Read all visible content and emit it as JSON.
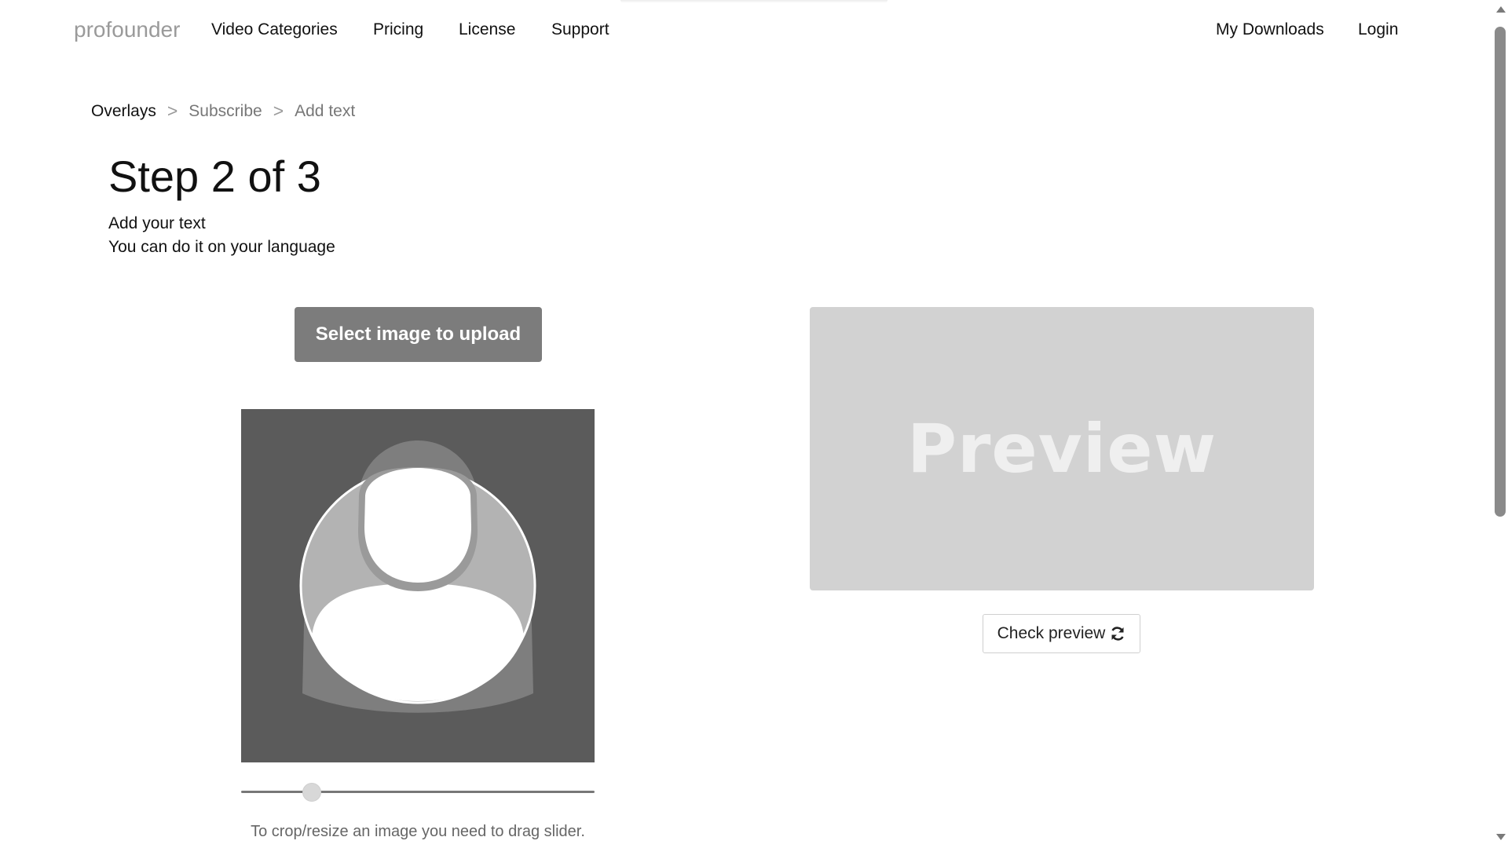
{
  "nav": {
    "brand": "profounder",
    "links": [
      "Video Categories",
      "Pricing",
      "License",
      "Support"
    ],
    "right_links": [
      "My Downloads",
      "Login"
    ]
  },
  "breadcrumb": {
    "items": [
      "Overlays",
      "Subscribe",
      "Add text"
    ],
    "separator": ">"
  },
  "step": {
    "title": "Step 2 of 3",
    "line1": "Add your text",
    "line2": "You can do it on your language"
  },
  "upload": {
    "button_label": "Select image to upload"
  },
  "crop": {
    "placeholder_icon": "user-silhouette-icon",
    "slider_value": 0.2,
    "hint": "To crop/resize an image you need to drag slider."
  },
  "preview": {
    "label": "Preview",
    "check_button_label": "Check preview",
    "check_button_icon": "refresh-icon"
  },
  "colors": {
    "upload_button": "#7c7c7c",
    "crop_background": "#5b5b5b",
    "preview_background": "#d2d2d2"
  }
}
